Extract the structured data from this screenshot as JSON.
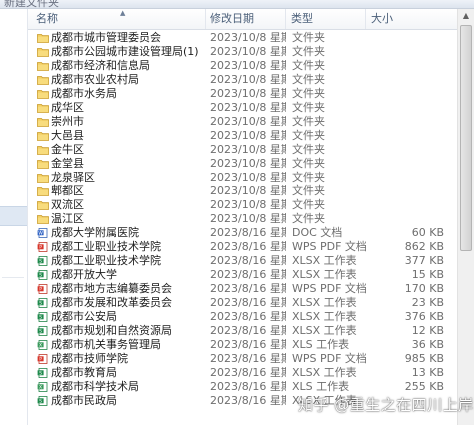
{
  "window": {
    "title": "新建文件夹"
  },
  "columns": {
    "name": "名称",
    "date": "修改日期",
    "type": "类型",
    "size": "大小"
  },
  "files": [
    {
      "name": "成都市城市管理委员会",
      "date": "2023/10/8 星期...",
      "type": "文件夹",
      "size": "",
      "icon": "folder-icon"
    },
    {
      "name": "成都市公园城市建设管理局(1)",
      "date": "2023/10/8 星期...",
      "type": "文件夹",
      "size": "",
      "icon": "folder-icon"
    },
    {
      "name": "成都市经济和信息局",
      "date": "2023/10/8 星期...",
      "type": "文件夹",
      "size": "",
      "icon": "folder-icon"
    },
    {
      "name": "成都市农业农村局",
      "date": "2023/10/8 星期...",
      "type": "文件夹",
      "size": "",
      "icon": "folder-icon"
    },
    {
      "name": "成都市水务局",
      "date": "2023/10/8 星期...",
      "type": "文件夹",
      "size": "",
      "icon": "folder-icon"
    },
    {
      "name": "成华区",
      "date": "2023/10/8 星期...",
      "type": "文件夹",
      "size": "",
      "icon": "folder-icon"
    },
    {
      "name": "崇州市",
      "date": "2023/10/8 星期...",
      "type": "文件夹",
      "size": "",
      "icon": "folder-icon"
    },
    {
      "name": "大邑县",
      "date": "2023/10/8 星期...",
      "type": "文件夹",
      "size": "",
      "icon": "folder-icon"
    },
    {
      "name": "金牛区",
      "date": "2023/10/8 星期...",
      "type": "文件夹",
      "size": "",
      "icon": "folder-icon"
    },
    {
      "name": "金堂县",
      "date": "2023/10/8 星期...",
      "type": "文件夹",
      "size": "",
      "icon": "folder-icon"
    },
    {
      "name": "龙泉驿区",
      "date": "2023/10/8 星期...",
      "type": "文件夹",
      "size": "",
      "icon": "folder-icon"
    },
    {
      "name": "郫都区",
      "date": "2023/10/8 星期...",
      "type": "文件夹",
      "size": "",
      "icon": "folder-icon"
    },
    {
      "name": "双流区",
      "date": "2023/10/8 星期...",
      "type": "文件夹",
      "size": "",
      "icon": "folder-icon"
    },
    {
      "name": "温江区",
      "date": "2023/10/8 星期...",
      "type": "文件夹",
      "size": "",
      "icon": "folder-icon"
    },
    {
      "name": "成都大学附属医院",
      "date": "2023/8/16 星期...",
      "type": "DOC 文档",
      "size": "60 KB",
      "icon": "doc-file-icon"
    },
    {
      "name": "成都工业职业技术学院",
      "date": "2023/8/16 星期...",
      "type": "WPS PDF 文档",
      "size": "862 KB",
      "icon": "pdf-file-icon"
    },
    {
      "name": "成都工业职业技术学院",
      "date": "2023/8/16 星期...",
      "type": "XLSX 工作表",
      "size": "377 KB",
      "icon": "xlsx-file-icon"
    },
    {
      "name": "成都开放大学",
      "date": "2023/8/16 星期...",
      "type": "XLSX 工作表",
      "size": "15 KB",
      "icon": "xlsx-file-icon"
    },
    {
      "name": "成都市地方志编纂委员会",
      "date": "2023/8/16 星期...",
      "type": "WPS PDF 文档",
      "size": "170 KB",
      "icon": "pdf-file-icon"
    },
    {
      "name": "成都市发展和改革委员会",
      "date": "2023/8/16 星期...",
      "type": "XLSX 工作表",
      "size": "23 KB",
      "icon": "xlsx-file-icon"
    },
    {
      "name": "成都市公安局",
      "date": "2023/8/16 星期...",
      "type": "XLSX 工作表",
      "size": "376 KB",
      "icon": "xlsx-file-icon"
    },
    {
      "name": "成都市规划和自然资源局",
      "date": "2023/8/16 星期...",
      "type": "XLSX 工作表",
      "size": "12 KB",
      "icon": "xlsx-file-icon"
    },
    {
      "name": "成都市机关事务管理局",
      "date": "2023/8/16 星期...",
      "type": "XLS 工作表",
      "size": "36 KB",
      "icon": "xls-file-icon"
    },
    {
      "name": "成都市技师学院",
      "date": "2023/8/16 星期...",
      "type": "WPS PDF 文档",
      "size": "985 KB",
      "icon": "pdf-file-icon"
    },
    {
      "name": "成都市教育局",
      "date": "2023/8/16 星期...",
      "type": "XLSX 工作表",
      "size": "13 KB",
      "icon": "xlsx-file-icon"
    },
    {
      "name": "成都市科学技术局",
      "date": "2023/8/16 星期...",
      "type": "XLS 工作表",
      "size": "255 KB",
      "icon": "xls-file-icon"
    },
    {
      "name": "成都市民政局",
      "date": "2023/8/16 星期...",
      "type": "XLSX 工作表",
      "size": "",
      "icon": "xlsx-file-icon"
    }
  ],
  "watermark": "知乎 @重生之在四川上岸"
}
